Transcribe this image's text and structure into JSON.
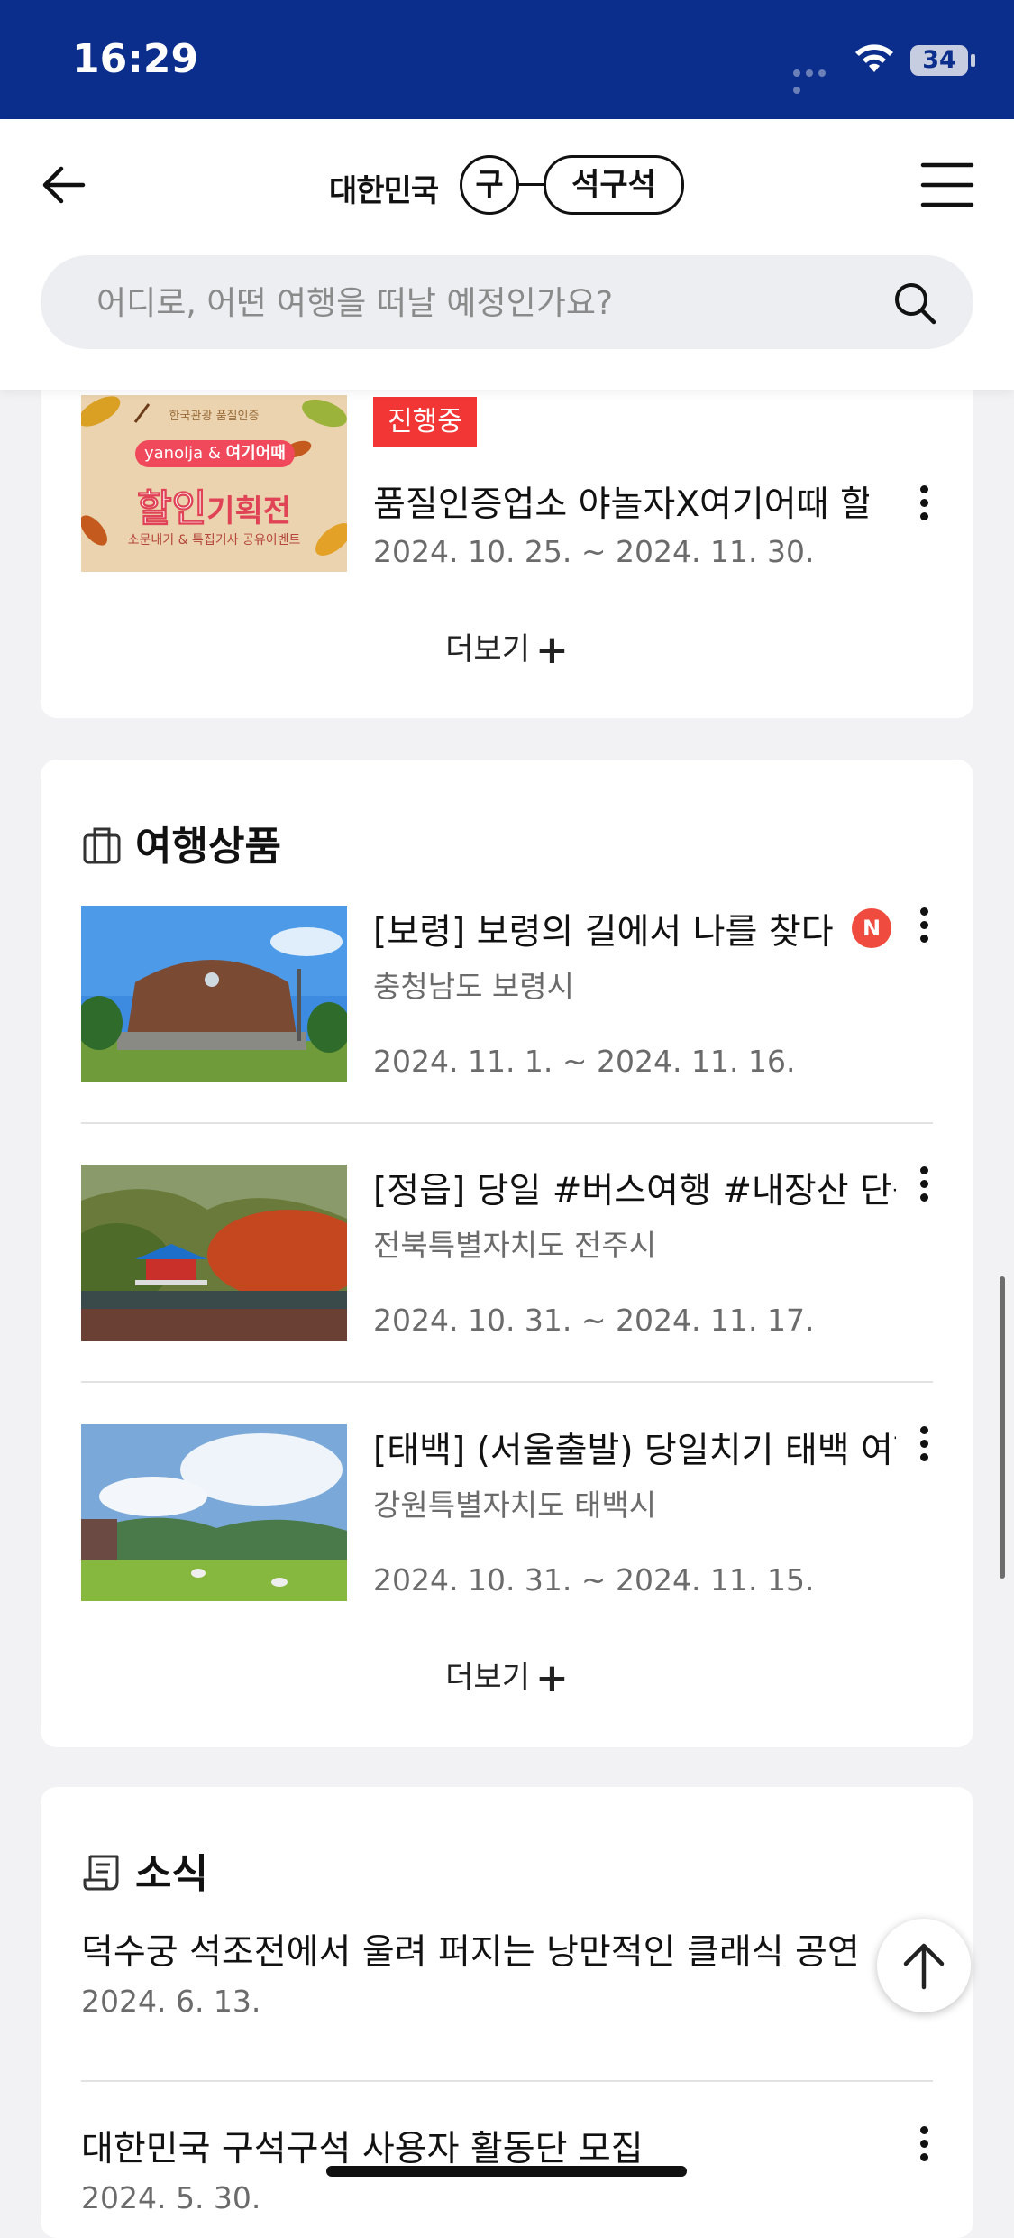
{
  "status": {
    "time": "16:29",
    "battery": "34"
  },
  "header": {
    "logo_prefix": "대한민국",
    "logo_circle": "구",
    "logo_pill": "석구석",
    "search_placeholder": "어디로, 어떤 여행을 떠날 예정인가요?"
  },
  "event": {
    "badge": "진행중",
    "title": "품질인증업소 야놀자X여기어때 할인기획전",
    "dates": "2024. 10. 25. ~ 2024. 11. 30.",
    "thumb_top": "한국관광 품질인증",
    "thumb_brand_a": "yanolja",
    "thumb_brand_b": "여기어때",
    "thumb_main_a": "할인",
    "thumb_main_b": "기획전",
    "thumb_sub": "소문내기 & 특집기사 공유이벤트",
    "more": "더보기"
  },
  "products": {
    "title": "여행상품",
    "items": [
      {
        "title": "[보령] 보령의 길에서 나를 찾다",
        "region": "충청남도 보령시",
        "dates": "2024. 11. 1. ~ 2024. 11. 16.",
        "new": "N"
      },
      {
        "title": "[정읍] 당일 #버스여행 #내장산 단풍",
        "region": "전북특별자치도 전주시",
        "dates": "2024. 10. 31. ~ 2024. 11. 17."
      },
      {
        "title": "[태백] (서울출발) 당일치기 태백 여행",
        "region": "강원특별자치도 태백시",
        "dates": "2024. 10. 31. ~ 2024. 11. 15."
      }
    ],
    "more": "더보기"
  },
  "news": {
    "title": "소식",
    "items": [
      {
        "title": "덕수궁 석조전에서 울려 퍼지는 낭만적인 클래식 공연",
        "date": "2024. 6. 13."
      },
      {
        "title": "대한민국 구석구석 사용자 활동단 모집",
        "date": "2024. 5. 30."
      }
    ]
  }
}
